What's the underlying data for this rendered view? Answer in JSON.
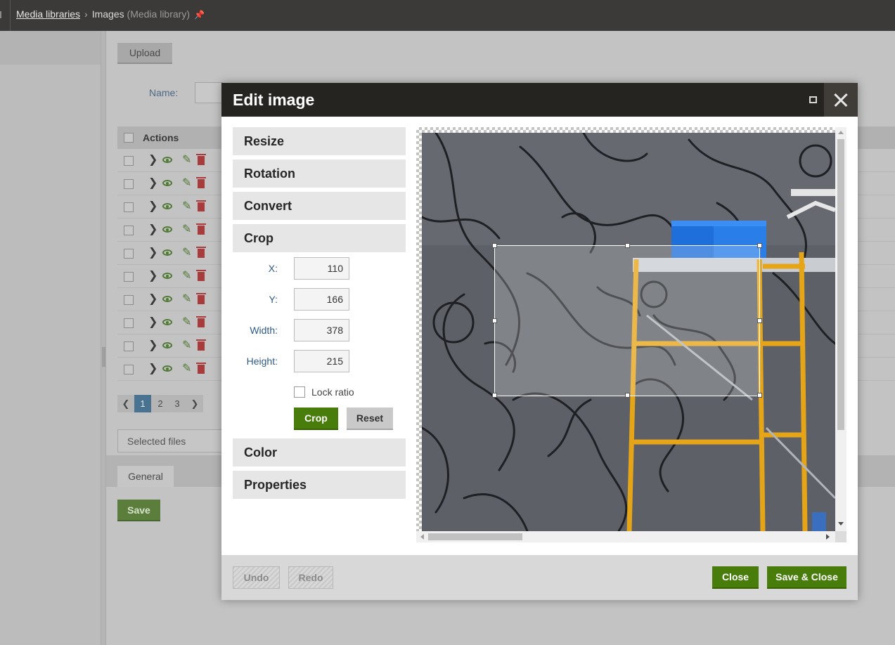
{
  "breadcrumb": {
    "parent": "Media libraries",
    "current": "Images",
    "current_suffix": "(Media library)"
  },
  "page": {
    "upload_label": "Upload",
    "name_filter_label": "Name:",
    "grid_actions_header": "Actions",
    "row_count": 10,
    "pager": {
      "pages": [
        "1",
        "2",
        "3"
      ],
      "active_page": "1"
    },
    "selected_files_label": "Selected files",
    "tab_general": "General",
    "save_label": "Save"
  },
  "dialog": {
    "title": "Edit image",
    "sections": {
      "resize": "Resize",
      "rotation": "Rotation",
      "convert": "Convert",
      "crop": "Crop",
      "color": "Color",
      "properties": "Properties"
    },
    "crop": {
      "x_label": "X:",
      "x_value": "110",
      "y_label": "Y:",
      "y_value": "166",
      "width_label": "Width:",
      "width_value": "378",
      "height_label": "Height:",
      "height_value": "215",
      "lock_ratio_label": "Lock ratio",
      "lock_ratio_checked": false,
      "crop_button": "Crop",
      "reset_button": "Reset"
    },
    "footer": {
      "undo": "Undo",
      "redo": "Redo",
      "close": "Close",
      "save_close": "Save & Close"
    }
  },
  "colors": {
    "primary_green": "#497d0b",
    "header_dark": "#262421",
    "link_blue": "#2d5a86"
  },
  "icons": [
    "chevron-right-icon",
    "eye-icon",
    "pencil-icon",
    "trash-icon",
    "pin-icon",
    "maximize-icon",
    "close-icon"
  ]
}
